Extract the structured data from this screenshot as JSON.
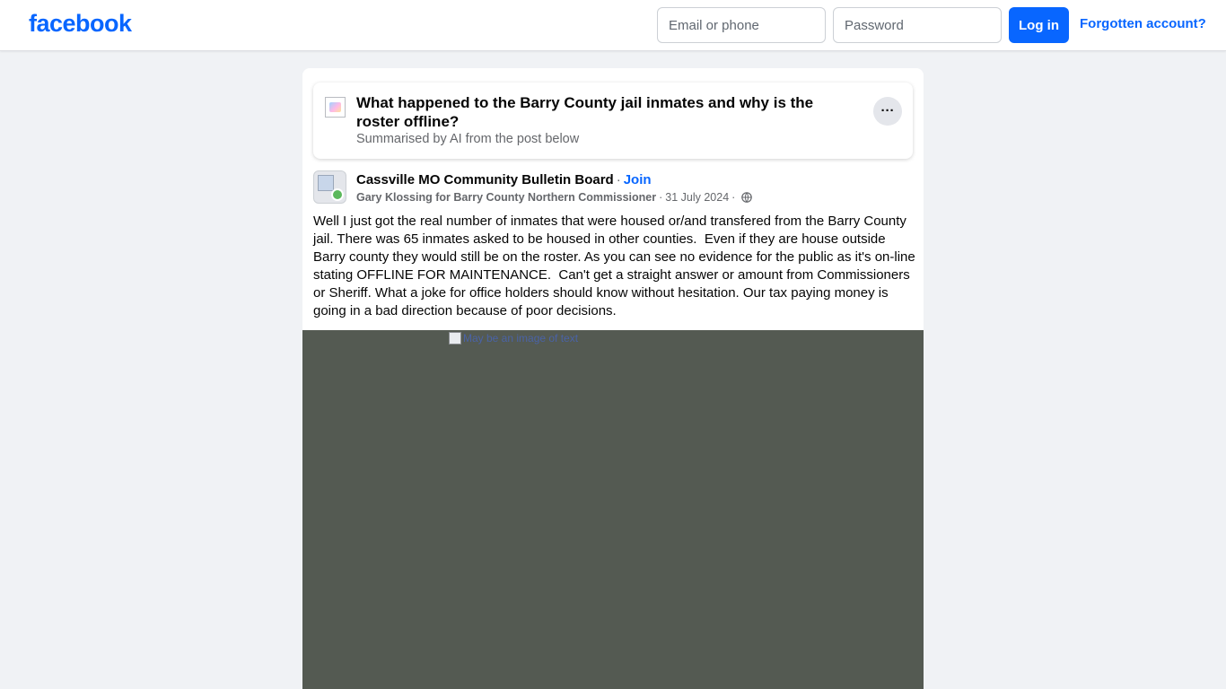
{
  "header": {
    "logo": "facebook",
    "email_placeholder": "Email or phone",
    "password_placeholder": "Password",
    "login_label": "Log in",
    "forgot_label": "Forgotten account?"
  },
  "ai_summary": {
    "title": "What happened to the Barry County jail inmates and why is the roster offline?",
    "subtitle": "Summarised by AI from the post below",
    "more_label": "···"
  },
  "post": {
    "group_name": "Cassville MO Community Bulletin Board",
    "separator": "·",
    "join_label": "Join",
    "author": "Gary Klossing for Barry County Northern Commissioner",
    "date": "31 July 2024",
    "body": "Well I just got the real number of inmates that were housed or/and transfered from the Barry County jail. There was 65 inmates asked to be housed in other counties.  Even if they are house outside Barry county they would still be on the roster. As you can see no evidence for the public as it's on-line stating OFFLINE FOR MAINTENANCE.  Can't get a straight answer or amount from Commissioners or Sheriff. What a joke for office holders should know without hesitation. Our tax paying money is going in a bad direction because of poor decisions.",
    "media_alt": "May be an image of text"
  },
  "colors": {
    "brand": "#0866ff",
    "background": "#f0f2f5",
    "media_bg": "#545a52"
  },
  "icons": {
    "privacy": "globe-icon",
    "more": "more-dots-icon"
  }
}
